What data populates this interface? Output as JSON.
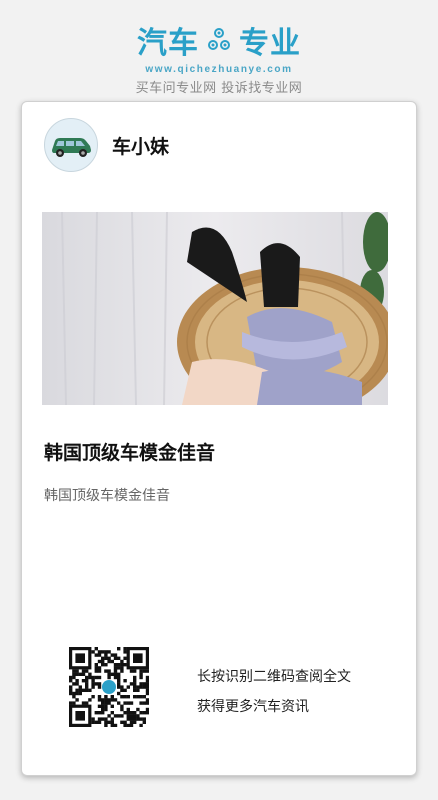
{
  "brand": {
    "title_left": "汽车",
    "title_right": "专业",
    "gear_icon": "gear-cluster-icon",
    "url": "www.qichezhuanye.com",
    "tagline": "买车问专业网 投诉找专业网",
    "color": "#2aa0c8"
  },
  "author": {
    "name": "车小妹",
    "avatar_icon": "green-suv-icon"
  },
  "article": {
    "hero_image": "photo-woman-in-rattan-chair",
    "title": "韩国顶级车模金佳音",
    "summary": "韩国顶级车模金佳音"
  },
  "qr": {
    "line1": "长按识别二维码查阅全文",
    "line2": "获得更多汽车资讯"
  }
}
